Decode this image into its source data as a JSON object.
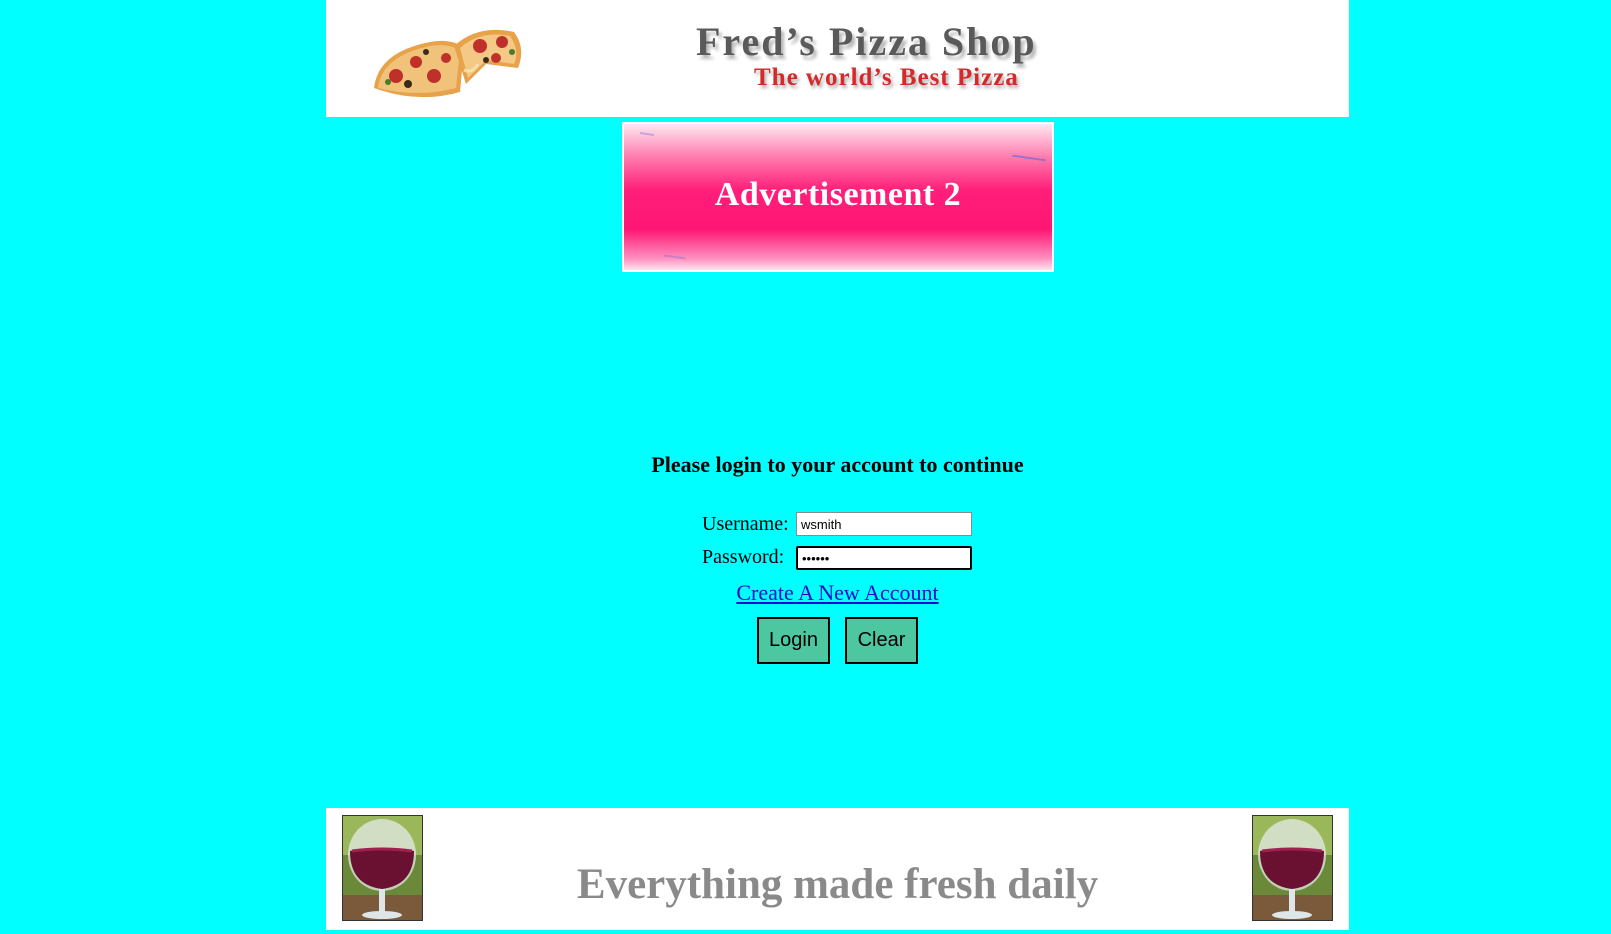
{
  "header": {
    "title": "Fred’s Pizza Shop",
    "tagline": "The world’s Best Pizza",
    "logo_icon": "pizza-icon"
  },
  "advertisement": {
    "text": "Advertisement 2",
    "colors": {
      "main": "#ff1574"
    }
  },
  "login": {
    "heading": "Please login to your account to continue",
    "username_label": "Username:",
    "username_value": "wsmith",
    "password_label": "Password:",
    "password_value": "••••••",
    "create_account_link": "Create A New Account",
    "login_button": "Login",
    "clear_button": "Clear"
  },
  "footer": {
    "text": "Everything made fresh daily",
    "image_icon": "wine-glass-icon"
  },
  "colors": {
    "page_background": "#00ffff",
    "button_background": "#4dc79f",
    "link": "#1a0dcc"
  }
}
